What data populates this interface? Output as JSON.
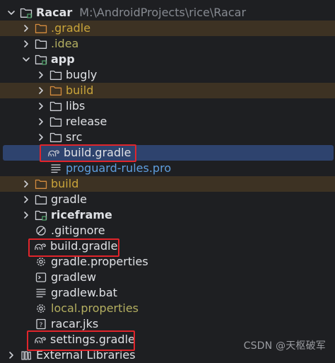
{
  "project": {
    "name": "Racar",
    "path": "M:\\AndroidProjects\\rice\\Racar"
  },
  "rows": {
    "gradle_hidden": ".gradle",
    "idea": ".idea",
    "app": "app",
    "bugly": "bugly",
    "app_build": "build",
    "libs": "libs",
    "release": "release",
    "src": "src",
    "app_build_gradle": "build.gradle",
    "proguard": "proguard-rules.pro",
    "root_build": "build",
    "gradle": "gradle",
    "riceframe": "riceframe",
    "gitignore": ".gitignore",
    "root_build_gradle": "build.gradle",
    "gradle_properties": "gradle.properties",
    "gradlew": "gradlew",
    "gradlew_bat": "gradlew.bat",
    "local_properties": "local.properties",
    "racar_jks": "racar.jks",
    "settings_gradle": "settings.gradle",
    "external_libraries": "External Libraries"
  },
  "watermark": "CSDN @天枢破军",
  "colors": {
    "background": "#1e1f22",
    "selection": "#2e436e",
    "excluded_row": "#3d3223",
    "highlight_box": "#e0252b",
    "excluded_text": "#c9a43a",
    "generated_text": "#b3ae60",
    "module_text": "#5f9ede"
  },
  "icons": {
    "expanded": "chevron-down-icon",
    "collapsed": "chevron-right-icon",
    "folder": "folder-icon",
    "module": "module-folder-icon",
    "gradle": "gradle-elephant-icon",
    "text_file": "text-file-icon",
    "gear": "gear-icon",
    "terminal": "terminal-icon",
    "keystore": "question-file-icon",
    "git_ignore": "ignore-file-icon"
  }
}
